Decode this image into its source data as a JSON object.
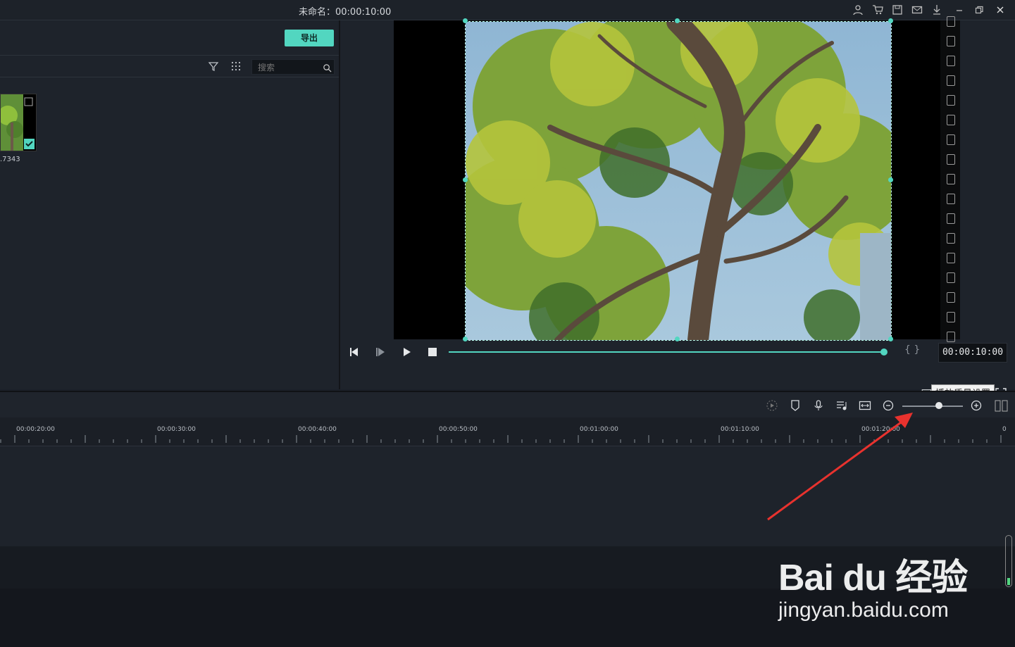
{
  "titlebar": {
    "title": "未命名：00:00:10:00",
    "icons": [
      "account-icon",
      "cart-icon",
      "save-icon",
      "mail-icon",
      "download-icon",
      "minimize-icon",
      "restore-icon",
      "close-icon"
    ]
  },
  "media": {
    "export_label": "导出",
    "search_placeholder": "搜索",
    "thumb_label": ".7343"
  },
  "preview": {
    "timecode": "00:00:10:00",
    "progress": 1.0,
    "tooltip": "播放质量设置",
    "bracket_label": "{ }"
  },
  "timeline": {
    "ticks": [
      "00:00:20:00",
      "00:00:30:00",
      "00:00:40:00",
      "00:00:50:00",
      "00:01:00:00",
      "00:01:10:00",
      "00:01:20:00",
      "0"
    ]
  },
  "watermark": {
    "logo": "Bai du 经验",
    "url": "jingyan.baidu.com"
  },
  "colors": {
    "accent": "#52d6c0",
    "background": "#1b2028",
    "arrow": "#e8322e"
  }
}
